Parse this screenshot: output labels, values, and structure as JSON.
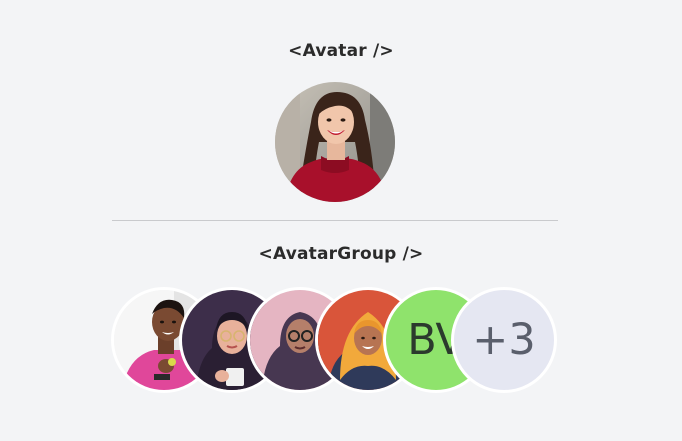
{
  "headings": {
    "avatar": "<Avatar />",
    "avatar_group": "<AvatarGroup />"
  },
  "single_avatar": {
    "icon": "woman-red-sweater-photo"
  },
  "group": {
    "avatars": [
      {
        "icon": "man-pink-shirt-photo"
      },
      {
        "icon": "woman-glasses-hijab-illustration"
      },
      {
        "icon": "woman-hijab-glasses-illustration"
      },
      {
        "icon": "woman-orange-hijab-illustration"
      },
      {
        "initials": "BV",
        "color": "#8fe36c"
      },
      {
        "overflow": "+3",
        "color": "#e5e7f2"
      }
    ]
  },
  "colors": {
    "background": "#f3f4f6",
    "divider": "#c9cacd"
  }
}
